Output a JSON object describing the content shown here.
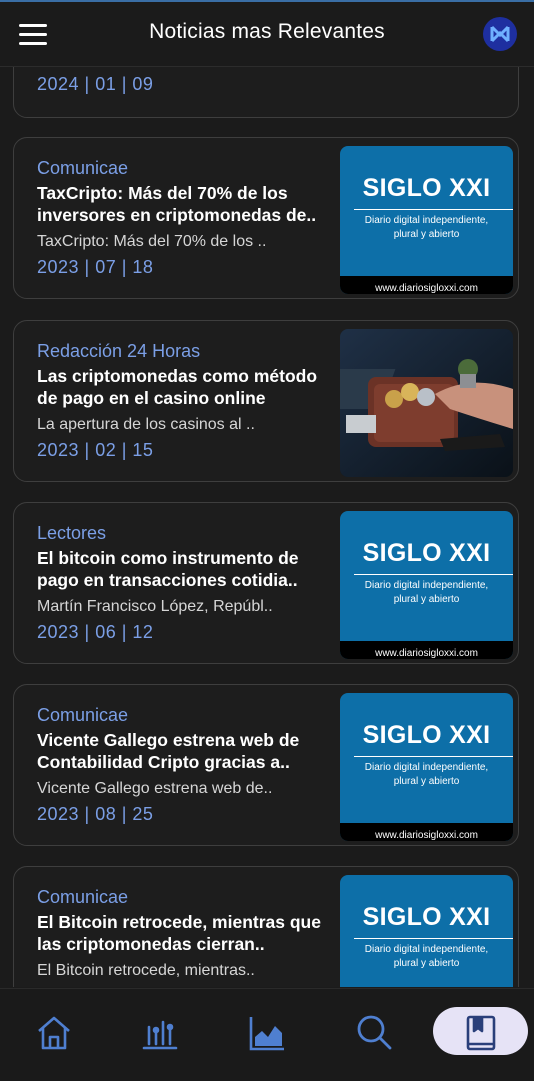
{
  "app": {
    "title": "Noticias mas Relevantes",
    "menu_icon": "hamburger-menu-icon",
    "logo_icon": "app-logo-icon"
  },
  "colors": {
    "background": "#1b1b1b",
    "accent": "#7b9fe6",
    "card_border": "#3e3e3e",
    "siglo_blue": "#0d6fa8",
    "active_nav": "#e6e3f6"
  },
  "news": [
    {
      "source": "",
      "headline": "",
      "snippet": "",
      "date": "2024 | 01 | 09",
      "thumb": ""
    },
    {
      "source": "Comunicae",
      "headline": "TaxCripto: Más del 70% de los inversores en criptomonedas de..",
      "snippet": "TaxCripto: Más del 70% de los ..",
      "date": "2023 | 07 | 18",
      "thumb": "siglo"
    },
    {
      "source": "Redacción 24 Horas",
      "headline": "Las criptomonedas como método de pago en el casino online",
      "snippet": "La apertura de los casinos al ..",
      "date": "2023 | 02 | 15",
      "thumb": "photo"
    },
    {
      "source": "Lectores",
      "headline": "El bitcoin como instrumento de pago en transacciones cotidia..",
      "snippet": "Martín Francisco López, Repúbl..",
      "date": "2023 | 06 | 12",
      "thumb": "siglo"
    },
    {
      "source": "Comunicae",
      "headline": "Vicente Gallego estrena web de Contabilidad Cripto gracias a..",
      "snippet": "Vicente Gallego estrena web de..",
      "date": "2023 | 08 | 25",
      "thumb": "siglo"
    },
    {
      "source": "Comunicae",
      "headline": "El Bitcoin retrocede, mientras que las criptomonedas cierran..",
      "snippet": "El Bitcoin retrocede, mientras..",
      "date": "",
      "thumb": "siglo"
    }
  ],
  "siglo_thumb": {
    "title": "SIGLO XXI",
    "subtitle_line1": "Diario digital independiente,",
    "subtitle_line2": "plural y abierto",
    "footer": "www.diariosigloxxi.com"
  },
  "bottom_nav": [
    {
      "icon": "home-icon",
      "active": false
    },
    {
      "icon": "bar-chart-icon",
      "active": false
    },
    {
      "icon": "area-chart-icon",
      "active": false
    },
    {
      "icon": "search-icon",
      "active": false
    },
    {
      "icon": "bookmark-icon",
      "active": true
    }
  ]
}
